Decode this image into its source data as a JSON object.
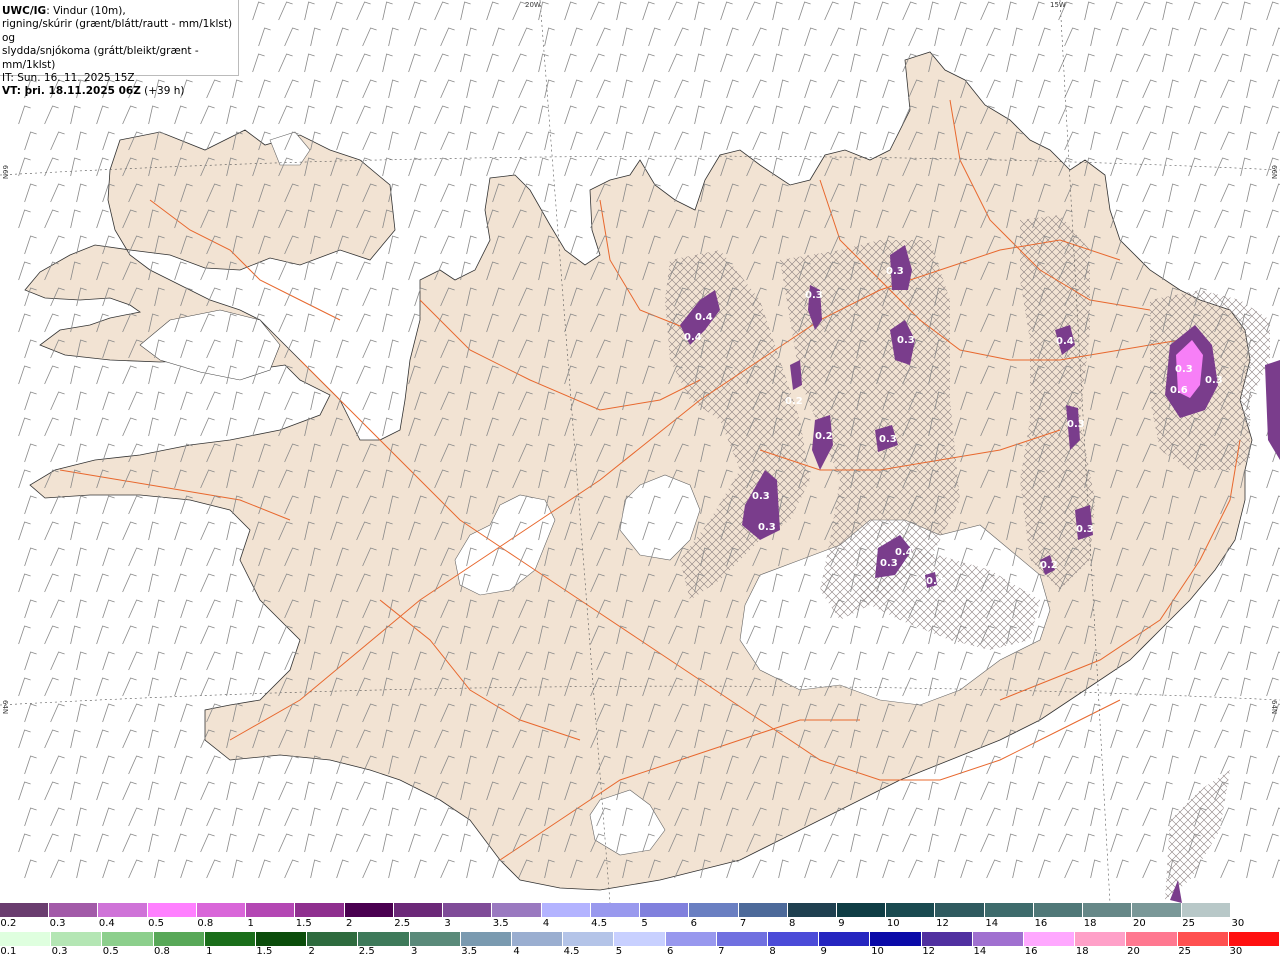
{
  "title": {
    "model": "UWC/IG",
    "line1_rest": ": Vindur (10m),",
    "line2": "rigning/skúrir (grænt/blátt/rautt - mm/1klst) og",
    "line3": "slydda/snjókoma (grátt/bleikt/grænt - mm/1klst)",
    "it": "IT: Sun. 16. 11. 2025 15Z",
    "vt_label": "VT: þri. 18.11.2025 06Z",
    "vt_offset": " (+39 h)"
  },
  "grid_labels": {
    "lon_20w": "20W",
    "lon_15w": "15W",
    "lat_66n_left": "66N",
    "lat_66n_right": "66N",
    "lat_64n_left": "64N",
    "lat_64n_right": "64N"
  },
  "precip_labels": [
    "0.4",
    "0.4",
    "0.3",
    "0.3",
    "0.2",
    "0.3",
    "0.3",
    "0.3",
    "0.4",
    "0.3",
    "0.3",
    "0.4",
    "0.3",
    "0.3",
    "0.2",
    "0.6",
    "0.3",
    "0.3",
    "0.2",
    "0.2"
  ],
  "colors": {
    "land": "#f2e3d3",
    "glacier": "#ffffff",
    "roads": "#e8682e",
    "wind_barbs": "#8a8a8a",
    "snow_purple": "#7a3d8c",
    "snow_magenta": "#f77ff7"
  },
  "legend_snow": {
    "labels": [
      "0.2",
      "0.3",
      "0.4",
      "0.5",
      "0.8",
      "1",
      "1.5",
      "2",
      "2.5",
      "3",
      "3.5",
      "4",
      "4.5",
      "5",
      "6",
      "7",
      "8",
      "9",
      "10",
      "12",
      "14",
      "16",
      "18",
      "20",
      "25",
      "30"
    ],
    "colors": [
      "#6a3d6f",
      "#a25aa8",
      "#cf73d8",
      "#ff80ff",
      "#d966d9",
      "#b447b4",
      "#8f2f8f",
      "#4a0050",
      "#6b2878",
      "#7f4b98",
      "#9a79c0",
      "#b3b3ff",
      "#9999ee",
      "#8080dd",
      "#6a7fc2",
      "#4d6a9a",
      "#1f4050",
      "#0f3d45",
      "#1a4a50",
      "#2f5a5f",
      "#3e6b6c",
      "#507878",
      "#668888",
      "#7a9898",
      "#b8c8c8",
      "#ffffff"
    ]
  },
  "legend_rain": {
    "labels": [
      "0.1",
      "0.3",
      "0.5",
      "0.8",
      "1",
      "1.5",
      "2",
      "2.5",
      "3",
      "3.5",
      "4",
      "4.5",
      "5",
      "6",
      "7",
      "8",
      "9",
      "10",
      "12",
      "14",
      "16",
      "18",
      "20",
      "25",
      "30"
    ],
    "colors": [
      "#dfffdf",
      "#b4e6b4",
      "#8ccf8c",
      "#58a858",
      "#1a6e1a",
      "#0b4d0b",
      "#2e6b3e",
      "#3e7a5a",
      "#5a8a7a",
      "#7a9ab0",
      "#9aaed0",
      "#b4c4e8",
      "#c8d0ff",
      "#9898ee",
      "#7070e0",
      "#4b4bd8",
      "#2626c0",
      "#0a0aa8",
      "#5030a0",
      "#a070d0",
      "#ffa8ff",
      "#ffa0c8",
      "#ff7890",
      "#ff5050",
      "#ff1010"
    ]
  }
}
